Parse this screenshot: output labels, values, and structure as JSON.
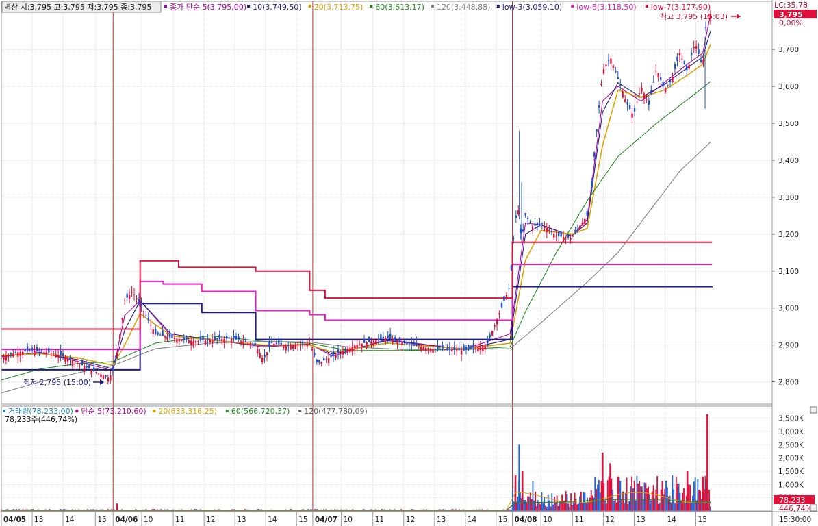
{
  "chart_data": [
    {
      "type": "line",
      "panel": "price",
      "header": {
        "stock": "벽산",
        "ohlc": "시:3,795 고:3,795 저:3,795 종:3,795"
      },
      "legend": [
        {
          "text": "종가 단순 5(3,795,00)",
          "color": "#b0009c"
        },
        {
          "text": "10(3,749,50)",
          "color": "#1a1a80"
        },
        {
          "text": "20(3,713,75)",
          "color": "#e0a000"
        },
        {
          "text": "60(3,613,17)",
          "color": "#208a20"
        },
        {
          "text": "120(3,448,88)",
          "color": "#808080"
        },
        {
          "text": "low-3(3,059,10)",
          "color": "#1a1a80"
        },
        {
          "text": "low-5(3,118,50)",
          "color": "#e020c0"
        },
        {
          "text": "low-7(3,177,90)",
          "color": "#e0103a"
        }
      ],
      "ylim": [
        2740,
        3830
      ],
      "y_ticks": [
        "2,800",
        "2,900",
        "3,000",
        "3,100",
        "3,200",
        "3,300",
        "3,400",
        "3,500",
        "3,600",
        "3,700"
      ],
      "right_labels": {
        "lc": "LC:35,78",
        "price": "3,795",
        "pct": "0,00%"
      },
      "annotations": {
        "high": "최고 3,795 (15:03)",
        "low": "최저 2,795 (15:00)"
      },
      "sessions": [
        {
          "label": "04/05",
          "start": 0,
          "end": 0.145
        },
        {
          "label": "04/06",
          "start": 0.145,
          "end": 0.404
        },
        {
          "label": "04/07",
          "start": 0.404,
          "end": 0.663
        },
        {
          "label": "04/08",
          "start": 0.663,
          "end": 0.922
        }
      ],
      "series": [
        {
          "name": "종가",
          "color": "#e0103a",
          "x": [
            0,
            0.02,
            0.04,
            0.06,
            0.08,
            0.1,
            0.12,
            0.13,
            0.14,
            0.145,
            0.15,
            0.16,
            0.17,
            0.18,
            0.2,
            0.22,
            0.25,
            0.28,
            0.3,
            0.33,
            0.34,
            0.35,
            0.37,
            0.4,
            0.41,
            0.43,
            0.46,
            0.5,
            0.53,
            0.56,
            0.6,
            0.63,
            0.66,
            0.665,
            0.67,
            0.675,
            0.68,
            0.69,
            0.7,
            0.72,
            0.74,
            0.76,
            0.765,
            0.77,
            0.78,
            0.79,
            0.8,
            0.81,
            0.82,
            0.83,
            0.84,
            0.85,
            0.86,
            0.87,
            0.88,
            0.89,
            0.9,
            0.91,
            0.915,
            0.92
          ],
          "y": [
            2865,
            2880,
            2885,
            2880,
            2870,
            2850,
            2830,
            2820,
            2810,
            2835,
            2870,
            3020,
            3045,
            3010,
            2930,
            2920,
            2910,
            2915,
            2918,
            2900,
            2860,
            2905,
            2898,
            2905,
            2850,
            2870,
            2900,
            2920,
            2900,
            2890,
            2885,
            2900,
            3060,
            3200,
            3280,
            3180,
            3250,
            3220,
            3230,
            3195,
            3190,
            3250,
            3300,
            3430,
            3640,
            3680,
            3620,
            3560,
            3520,
            3600,
            3550,
            3650,
            3590,
            3620,
            3690,
            3640,
            3720,
            3650,
            3790,
            3795
          ]
        },
        {
          "name": "5",
          "color": "#b0009c",
          "x": [
            0,
            0.05,
            0.1,
            0.145,
            0.16,
            0.18,
            0.22,
            0.28,
            0.34,
            0.4,
            0.43,
            0.5,
            0.6,
            0.66,
            0.68,
            0.7,
            0.74,
            0.76,
            0.78,
            0.8,
            0.83,
            0.86,
            0.89,
            0.91,
            0.92
          ],
          "y": [
            2868,
            2880,
            2855,
            2830,
            2980,
            3020,
            2925,
            2912,
            2895,
            2902,
            2870,
            2915,
            2888,
            2930,
            3230,
            3225,
            3195,
            3240,
            3560,
            3600,
            3560,
            3610,
            3660,
            3690,
            3795
          ]
        },
        {
          "name": "10",
          "color": "#1a1a80",
          "x": [
            0,
            0.05,
            0.1,
            0.145,
            0.16,
            0.18,
            0.22,
            0.28,
            0.34,
            0.4,
            0.43,
            0.5,
            0.6,
            0.66,
            0.68,
            0.7,
            0.74,
            0.76,
            0.78,
            0.8,
            0.83,
            0.86,
            0.89,
            0.91,
            0.92
          ],
          "y": [
            2870,
            2878,
            2860,
            2835,
            2940,
            3020,
            2930,
            2912,
            2898,
            2902,
            2875,
            2912,
            2888,
            2915,
            3200,
            3225,
            3195,
            3230,
            3530,
            3610,
            3570,
            3605,
            3650,
            3680,
            3750
          ]
        },
        {
          "name": "20",
          "color": "#e0a000",
          "x": [
            0,
            0.05,
            0.1,
            0.145,
            0.16,
            0.18,
            0.22,
            0.28,
            0.34,
            0.4,
            0.43,
            0.5,
            0.6,
            0.66,
            0.68,
            0.7,
            0.74,
            0.76,
            0.78,
            0.8,
            0.83,
            0.86,
            0.89,
            0.91,
            0.92
          ],
          "y": [
            2872,
            2876,
            2865,
            2845,
            2900,
            2985,
            2925,
            2912,
            2900,
            2900,
            2880,
            2905,
            2890,
            2905,
            3130,
            3210,
            3200,
            3215,
            3440,
            3590,
            3570,
            3590,
            3630,
            3660,
            3714
          ]
        },
        {
          "name": "60",
          "color": "#208a20",
          "x": [
            0,
            0.05,
            0.1,
            0.145,
            0.2,
            0.27,
            0.34,
            0.4,
            0.45,
            0.52,
            0.6,
            0.66,
            0.68,
            0.72,
            0.76,
            0.8,
            0.85,
            0.9,
            0.92
          ],
          "y": [
            2805,
            2835,
            2850,
            2855,
            2905,
            2925,
            2910,
            2905,
            2885,
            2885,
            2888,
            2895,
            2990,
            3150,
            3290,
            3410,
            3500,
            3580,
            3613
          ]
        },
        {
          "name": "120",
          "color": "#808080",
          "x": [
            0,
            0.05,
            0.1,
            0.145,
            0.2,
            0.27,
            0.34,
            0.4,
            0.45,
            0.52,
            0.6,
            0.66,
            0.7,
            0.76,
            0.8,
            0.84,
            0.88,
            0.92
          ],
          "y": [
            2770,
            2800,
            2825,
            2845,
            2890,
            2905,
            2910,
            2908,
            2895,
            2888,
            2888,
            2890,
            2960,
            3070,
            3150,
            3260,
            3370,
            3449
          ]
        },
        {
          "name": "low-3",
          "color": "#1a1a80",
          "step": true,
          "x": [
            0,
            0.145,
            0.18,
            0.26,
            0.33,
            0.42,
            0.66,
            0.663,
            0.922
          ],
          "y": [
            2833,
            2833,
            3012,
            2988,
            2915,
            2915,
            2915,
            3058,
            3059
          ]
        },
        {
          "name": "low-5",
          "color": "#e020c0",
          "step": true,
          "x": [
            0,
            0.145,
            0.18,
            0.21,
            0.26,
            0.33,
            0.4,
            0.42,
            0.66,
            0.663,
            0.922
          ],
          "y": [
            2888,
            2888,
            3072,
            3065,
            3045,
            2993,
            2982,
            2967,
            2967,
            3118,
            3118
          ]
        },
        {
          "name": "low-7",
          "color": "#e0103a",
          "step": true,
          "x": [
            0,
            0.145,
            0.18,
            0.23,
            0.33,
            0.4,
            0.42,
            0.66,
            0.663,
            0.922
          ],
          "y": [
            2943,
            2943,
            3128,
            3110,
            3100,
            3048,
            3027,
            3027,
            3178,
            3178
          ]
        }
      ]
    },
    {
      "type": "bar",
      "panel": "volume",
      "legend": [
        {
          "text": "거래량(78,233,00)",
          "color": "#2080c0"
        },
        {
          "text": "단순 5(73,210,60)",
          "color": "#b0009c"
        },
        {
          "text": "20(633,316,25)",
          "color": "#e0a000"
        },
        {
          "text": "60(566,720,37)",
          "color": "#208a20"
        },
        {
          "text": "120(477,780,09)",
          "color": "#606060"
        }
      ],
      "sub_label": "78,233주(446,74%)",
      "ylim": [
        0,
        3800
      ],
      "y_ticks": [
        "3,500K",
        "3,000K",
        "2,500K",
        "2,000K",
        "1,500K",
        "1,000K",
        "500K"
      ],
      "right_labels": {
        "value": "78,233",
        "pct": "446,74%"
      },
      "peaks": [
        {
          "x": 0.15,
          "v": 280,
          "c": "#e0103a"
        },
        {
          "x": 0.667,
          "v": 1350,
          "c": "#e0103a"
        },
        {
          "x": 0.672,
          "v": 2500,
          "c": "#2060d0"
        },
        {
          "x": 0.676,
          "v": 1500,
          "c": "#e0103a"
        },
        {
          "x": 0.78,
          "v": 2200,
          "c": "#e0103a"
        },
        {
          "x": 0.79,
          "v": 1800,
          "c": "#e0103a"
        },
        {
          "x": 0.8,
          "v": 1300,
          "c": "#e0103a"
        },
        {
          "x": 0.89,
          "v": 1500,
          "c": "#e0103a"
        },
        {
          "x": 0.91,
          "v": 1300,
          "c": "#e0103a"
        },
        {
          "x": 0.916,
          "v": 3650,
          "c": "#e0103a"
        }
      ]
    },
    {
      "type": "axis",
      "panel": "time",
      "x_ticks": [
        {
          "label": "04/05",
          "x": 0.0,
          "bold": true
        },
        {
          "label": "13",
          "x": 0.04
        },
        {
          "label": "14",
          "x": 0.08
        },
        {
          "label": "15",
          "x": 0.122
        },
        {
          "label": "04/06",
          "x": 0.145,
          "bold": true
        },
        {
          "label": "10",
          "x": 0.182
        },
        {
          "label": "11",
          "x": 0.223
        },
        {
          "label": "12",
          "x": 0.263
        },
        {
          "label": "13",
          "x": 0.303
        },
        {
          "label": "14",
          "x": 0.343
        },
        {
          "label": "15",
          "x": 0.383
        },
        {
          "label": "04/07",
          "x": 0.404,
          "bold": true
        },
        {
          "label": "10",
          "x": 0.441
        },
        {
          "label": "11",
          "x": 0.482
        },
        {
          "label": "12",
          "x": 0.522
        },
        {
          "label": "13",
          "x": 0.562
        },
        {
          "label": "14",
          "x": 0.602
        },
        {
          "label": "15",
          "x": 0.642
        },
        {
          "label": "04/08",
          "x": 0.663,
          "bold": true
        },
        {
          "label": "10",
          "x": 0.7
        },
        {
          "label": "11",
          "x": 0.741
        },
        {
          "label": "12",
          "x": 0.781
        },
        {
          "label": "13",
          "x": 0.821
        },
        {
          "label": "14",
          "x": 0.861
        },
        {
          "label": "15",
          "x": 0.901
        }
      ],
      "time_label": "15:30:00"
    }
  ]
}
